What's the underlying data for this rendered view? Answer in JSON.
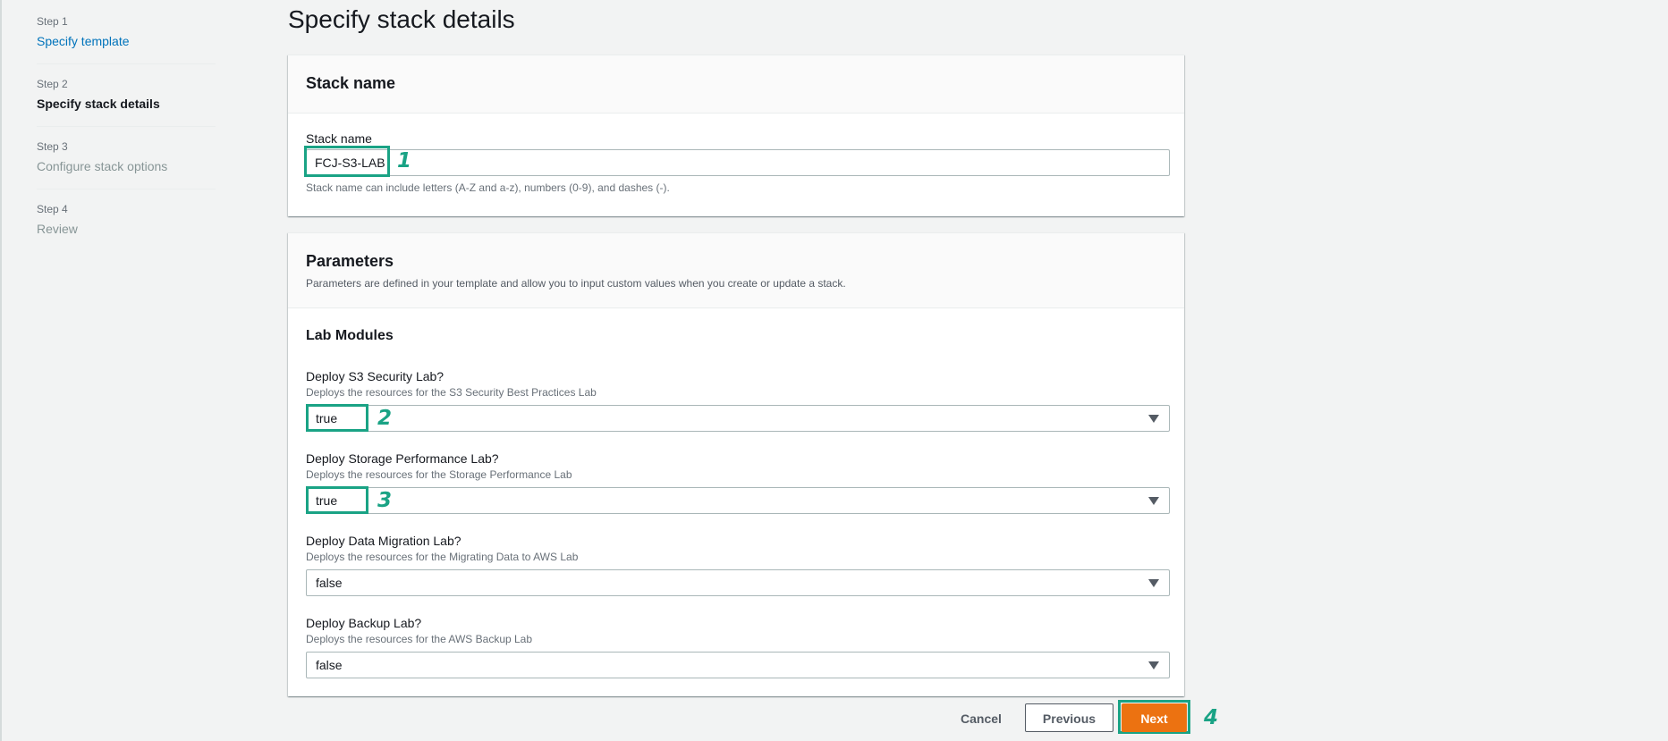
{
  "sidebar": {
    "steps": [
      {
        "num": "Step 1",
        "title": "Specify template"
      },
      {
        "num": "Step 2",
        "title": "Specify stack details"
      },
      {
        "num": "Step 3",
        "title": "Configure stack options"
      },
      {
        "num": "Step 4",
        "title": "Review"
      }
    ]
  },
  "page": {
    "title": "Specify stack details"
  },
  "stack_name_panel": {
    "header": "Stack name",
    "label": "Stack name",
    "value": "FCJ-S3-LAB",
    "hint": "Stack name can include letters (A-Z and a-z), numbers (0-9), and dashes (-)."
  },
  "parameters_panel": {
    "header": "Parameters",
    "description": "Parameters are defined in your template and allow you to input custom values when you create or update a stack.",
    "group_title": "Lab Modules",
    "fields": [
      {
        "label": "Deploy S3 Security Lab?",
        "desc": "Deploys the resources for the S3 Security Best Practices Lab",
        "value": "true"
      },
      {
        "label": "Deploy Storage Performance Lab?",
        "desc": "Deploys the resources for the Storage Performance Lab",
        "value": "true"
      },
      {
        "label": "Deploy Data Migration Lab?",
        "desc": "Deploys the resources for the Migrating Data to AWS Lab",
        "value": "false"
      },
      {
        "label": "Deploy Backup Lab?",
        "desc": "Deploys the resources for the AWS Backup Lab",
        "value": "false"
      }
    ]
  },
  "footer": {
    "cancel_label": "Cancel",
    "previous_label": "Previous",
    "next_label": "Next"
  },
  "annotations": [
    "1",
    "2",
    "3",
    "4"
  ],
  "colors": {
    "link": "#0073bb",
    "primary_button": "#ec7211",
    "annotation": "#1aa385"
  }
}
